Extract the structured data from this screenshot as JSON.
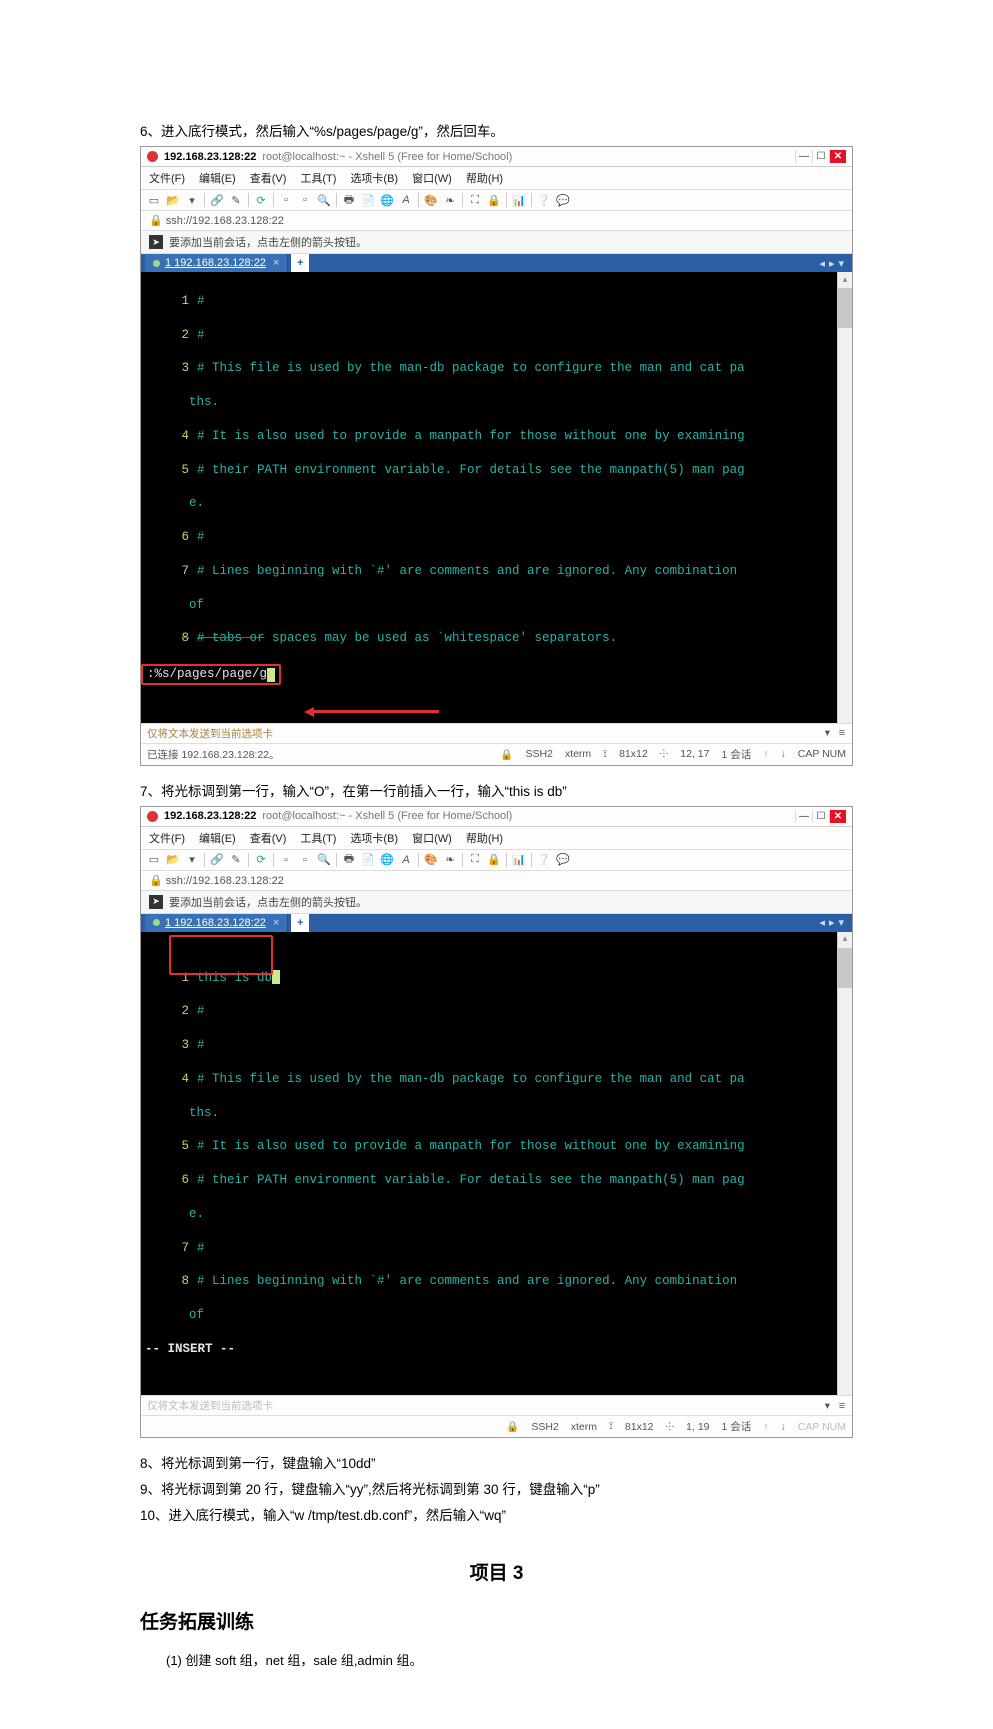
{
  "step6": "6、进入底行模式，然后输入“%s/pages/page/g”，然后回车。",
  "step7": "7、将光标调到第一行，输入“O”，在第一行前插入一行，输入“this is db”",
  "step8": "8、将光标调到第一行，键盘输入“10dd”",
  "step9": "9、将光标调到第 20 行，键盘输入“yy”,然后将光标调到第 30 行，键盘输入“p”",
  "step10": "10、进入底行模式，输入“w /tmp/test.db.conf”，然后输入“wq”",
  "proj": "项目 3",
  "task": "任务拓展训练",
  "sub1": "(1)  创建 soft 组，net 组，sale 组,admin 组。",
  "win": {
    "ip": "192.168.23.128:22",
    "sub": "root@localhost:~ - Xshell 5 (Free for Home/School)",
    "menu": [
      "文件(F)",
      "编辑(E)",
      "查看(V)",
      "工具(T)",
      "选项卡(B)",
      "窗口(W)",
      "帮助(H)"
    ],
    "url": "ssh://192.168.23.128:22",
    "hint": "要添加当前会话，点击左侧的箭头按钮。",
    "tab": "1 192.168.23.128:22",
    "foot_send": "仅将文本发送到当前选项卡",
    "foot_conn": "已连接 192.168.23.128:22。",
    "ssh": "SSH2",
    "xterm": "xterm",
    "rc1": "81x12",
    "pos1": "12, 17",
    "pos2": "1, 19",
    "sess": "1 会话",
    "cap": "CAP  NUM"
  },
  "t1": {
    "l1": "#",
    "l2": "#",
    "l3": "# This file is used by the man-db package to configure the man and cat pa",
    "l3b": "ths.",
    "l4": "# It is also used to provide a manpath for those without one by examining",
    "l5": "# their PATH environment variable. For details see the manpath(5) man pag",
    "l5b": "e.",
    "l6": "#",
    "l7": "# Lines beginning with `#' are comments and are ignored. Any combination",
    "l7b": "of",
    "l8": "# tabs or",
    "l8b": " spaces may be used as `whitespace' separators.",
    "cmd": ":%s/pages/page/g"
  },
  "t2": {
    "l1": "this is db",
    "l2": "#",
    "l3": "#",
    "l4": "# This file is used by the man-db package to configure the man and cat pa",
    "l4b": "ths.",
    "l5": "# It is also used to provide a manpath for those without one by examining",
    "l6": "# their PATH environment variable. For details see the manpath(5) man pag",
    "l6b": "e.",
    "l7": "#",
    "l8": "# Lines beginning with `#' are comments and are ignored. Any combination",
    "l8b": "of",
    "cmd": "-- INSERT --"
  }
}
